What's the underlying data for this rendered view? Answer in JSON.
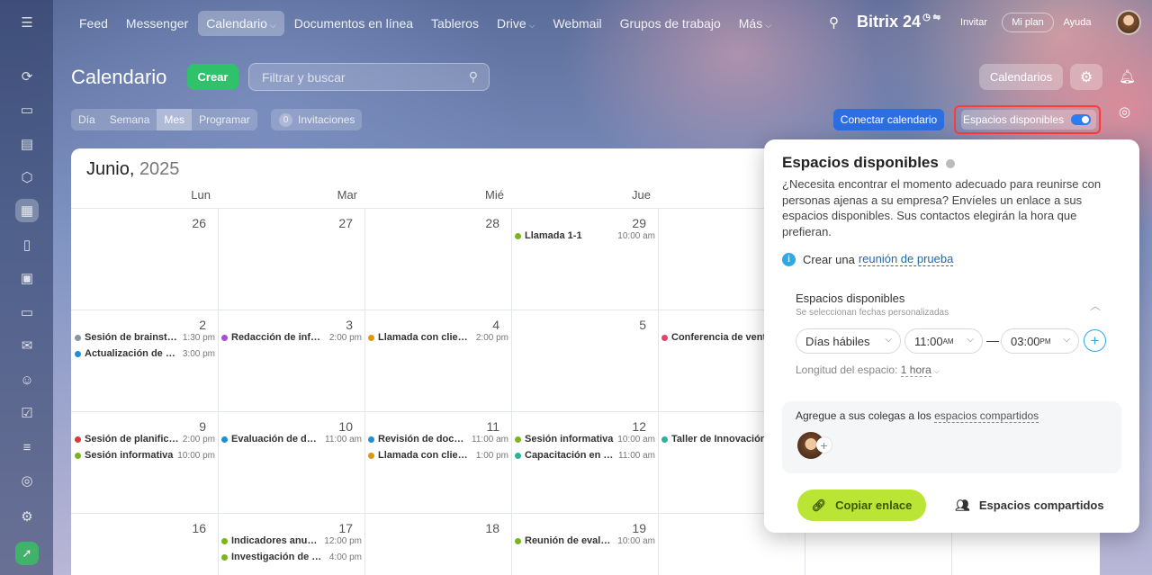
{
  "topnav": {
    "items": [
      {
        "label": "Feed"
      },
      {
        "label": "Messenger"
      },
      {
        "label": "Calendario"
      },
      {
        "label": "Documentos en línea"
      },
      {
        "label": "Tableros"
      },
      {
        "label": "Drive"
      },
      {
        "label": "Webmail"
      },
      {
        "label": "Grupos de trabajo"
      },
      {
        "label": "Más"
      }
    ],
    "logo": "Bitrix",
    "logo_num": "24",
    "invite": "Invitar",
    "plan": "Mi plan",
    "help": "Ayuda"
  },
  "header": {
    "title": "Calendario",
    "create": "Crear",
    "filter_placeholder": "Filtrar y buscar",
    "calendars": "Calendarios"
  },
  "views": [
    "Día",
    "Semana",
    "Mes",
    "Programar"
  ],
  "invitations": {
    "count": "0",
    "label": "Invitaciones"
  },
  "connect": "Conectar calendario",
  "spaces_toggle": "Espacios disponibles",
  "calendar": {
    "month": "Junio,",
    "year": "2025",
    "days": [
      "Lun",
      "Mar",
      "Mié",
      "Jue"
    ],
    "weeks": [
      {
        "nums": [
          "26",
          "27",
          "28",
          "29",
          ""
        ]
      },
      {
        "nums": [
          "2",
          "3",
          "4",
          "5",
          ""
        ]
      },
      {
        "nums": [
          "9",
          "10",
          "11",
          "12",
          ""
        ]
      },
      {
        "nums": [
          "16",
          "17",
          "18",
          "19",
          ""
        ]
      }
    ],
    "events": [
      {
        "col": 3,
        "row": 0,
        "slot": 0,
        "title": "Llamada 1-1",
        "time": "10:00 am",
        "color": "#7ab51d"
      },
      {
        "col": 0,
        "row": 1,
        "slot": 0,
        "title": "Sesión de brainstorming",
        "time": "1:30 pm",
        "color": "#8a94a3"
      },
      {
        "col": 0,
        "row": 1,
        "slot": 1,
        "title": "Actualización de estado",
        "time": "3:00 pm",
        "color": "#1c8fd6"
      },
      {
        "col": 1,
        "row": 1,
        "slot": 0,
        "title": "Redacción de informe",
        "time": "2:00 pm",
        "color": "#a64fcf"
      },
      {
        "col": 2,
        "row": 1,
        "slot": 0,
        "title": "Llamada con cliente",
        "time": "2:00 pm",
        "color": "#e0960d"
      },
      {
        "col": 4,
        "row": 1,
        "slot": 0,
        "title": "Conferencia de ventas",
        "time": "",
        "color": "#e0446a"
      },
      {
        "col": 0,
        "row": 2,
        "slot": 0,
        "title": "Sesión de planificación",
        "time": "2:00 pm",
        "color": "#d63a3a"
      },
      {
        "col": 0,
        "row": 2,
        "slot": 1,
        "title": "Sesión informativa",
        "time": "10:00 pm",
        "color": "#7ab51d"
      },
      {
        "col": 1,
        "row": 2,
        "slot": 0,
        "title": "Evaluación de desempeño",
        "time": "11:00 am",
        "color": "#1c8fd6"
      },
      {
        "col": 2,
        "row": 2,
        "slot": 0,
        "title": "Revisión de documentos",
        "time": "11:00 am",
        "color": "#1c8fd6"
      },
      {
        "col": 2,
        "row": 2,
        "slot": 1,
        "title": "Llamada con cliente",
        "time": "1:00 pm",
        "color": "#e0960d"
      },
      {
        "col": 3,
        "row": 2,
        "slot": 0,
        "title": "Sesión informativa",
        "time": "10:00 am",
        "color": "#7ab51d"
      },
      {
        "col": 3,
        "row": 2,
        "slot": 1,
        "title": "Capacitación en línea",
        "time": "11:00 am",
        "color": "#2bb39a"
      },
      {
        "col": 4,
        "row": 2,
        "slot": 0,
        "title": "Taller de Innovación",
        "time": "",
        "color": "#2bb39a"
      },
      {
        "col": 1,
        "row": 3,
        "slot": 0,
        "title": "Indicadores anuales",
        "time": "12:00 pm",
        "color": "#7ab51d"
      },
      {
        "col": 1,
        "row": 3,
        "slot": 1,
        "title": "Investigación de mercado",
        "time": "4:00 pm",
        "color": "#7ab51d"
      },
      {
        "col": 3,
        "row": 3,
        "slot": 0,
        "title": "Reunión de evaluación",
        "time": "10:00 am",
        "color": "#7ab51d"
      }
    ]
  },
  "popup": {
    "title": "Espacios disponibles",
    "description": "¿Necesita encontrar el momento adecuado para reunirse con personas ajenas a su empresa? Envíeles un enlace a sus espacios disponibles. Sus contactos elegirán la hora que prefieran.",
    "info_prefix": "Crear una",
    "info_link": "reunión de prueba",
    "section_title": "Espacios disponibles",
    "section_sub": "Se seleccionan fechas personalizadas",
    "days_select": "Días hábiles",
    "from_time": "11:00",
    "from_ampm": "AM",
    "to_time": "03:00",
    "to_ampm": "PM",
    "length_label": "Longitud del espacio:",
    "length_value": "1 hora",
    "colleagues_text": "Agregue a sus colegas a los",
    "colleagues_link": "espacios compartidos",
    "copy_button": "Copiar enlace",
    "shared_button": "Espacios compartidos"
  }
}
